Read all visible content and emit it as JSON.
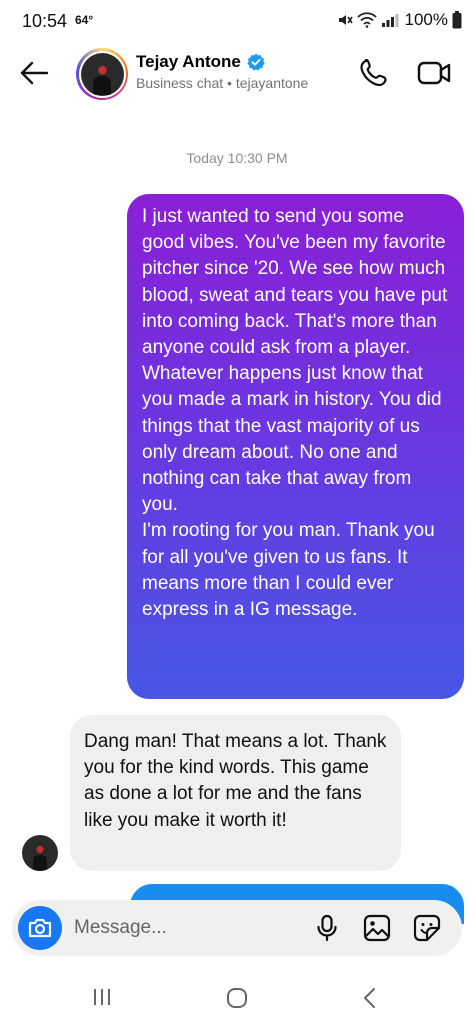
{
  "status_bar": {
    "time": "10:54",
    "temperature": "64°",
    "battery": "100%"
  },
  "header": {
    "contact_name": "Tejay Antone",
    "subtitle": "Business chat • tejayantone",
    "icons": {
      "back": "arrow-left-icon",
      "verified": "verified-badge-icon",
      "call": "phone-icon",
      "video": "video-camera-icon"
    }
  },
  "conversation": {
    "timestamp": "Today 10:30 PM",
    "messages": [
      {
        "direction": "outgoing",
        "paragraphs": [
          "I just wanted to send you some good vibes. You've been my favorite pitcher since '20. We see how much blood, sweat and tears you have put into coming back. That's more than anyone could ask from a player. Whatever happens just know that you made a mark in history. You did things that the vast majority of us only dream about. No one and nothing can take that away from you.",
          "I'm rooting for you man. Thank you for all you've given to us fans. It means more than I could ever express in a IG message."
        ]
      },
      {
        "direction": "incoming",
        "text": "Dang man! That means a lot. Thank you for the kind words. This game as done a lot for me and the fans like you make it worth it!"
      }
    ]
  },
  "composer": {
    "placeholder": "Message...",
    "icons": {
      "camera": "camera-icon",
      "mic": "microphone-icon",
      "gallery": "image-gallery-icon",
      "sticker": "sticker-icon"
    }
  },
  "colors": {
    "outgoing_gradient_top": "#8a1fd6",
    "outgoing_gradient_bottom": "#4756e6",
    "incoming_bubble": "#efefef",
    "accent_blue": "#1877f2"
  }
}
